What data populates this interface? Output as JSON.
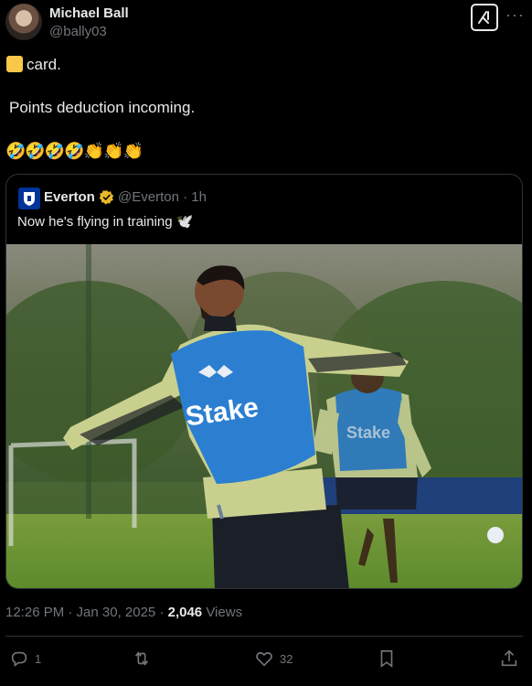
{
  "author": {
    "name": "Michael Ball",
    "handle": "@bally03"
  },
  "post": {
    "line1": "card.",
    "line2": "Points deduction incoming.",
    "emojis": "🤣🤣🤣🤣👏👏👏"
  },
  "quote": {
    "name": "Everton",
    "handle_time": "@Everton · 1h",
    "text": "Now he's flying in training 🕊️",
    "media_text": {
      "sponsor": "Stake"
    }
  },
  "meta": {
    "time_date": "12:26 PM · Jan 30, 2025 · ",
    "views_count": "2,046",
    "views_label": " Views"
  },
  "actions": {
    "replies": "1",
    "likes": "32"
  },
  "colors": {
    "background": "#000000",
    "muted": "#71767b",
    "text": "#e7e9ea",
    "border": "#2f3336",
    "verified_gold": "#e8b829",
    "everton_blue": "#003399"
  },
  "icons": [
    "grok-icon",
    "more-icon",
    "verified-badge-icon",
    "reply-icon",
    "repost-icon",
    "like-icon",
    "bookmark-icon",
    "share-icon"
  ]
}
